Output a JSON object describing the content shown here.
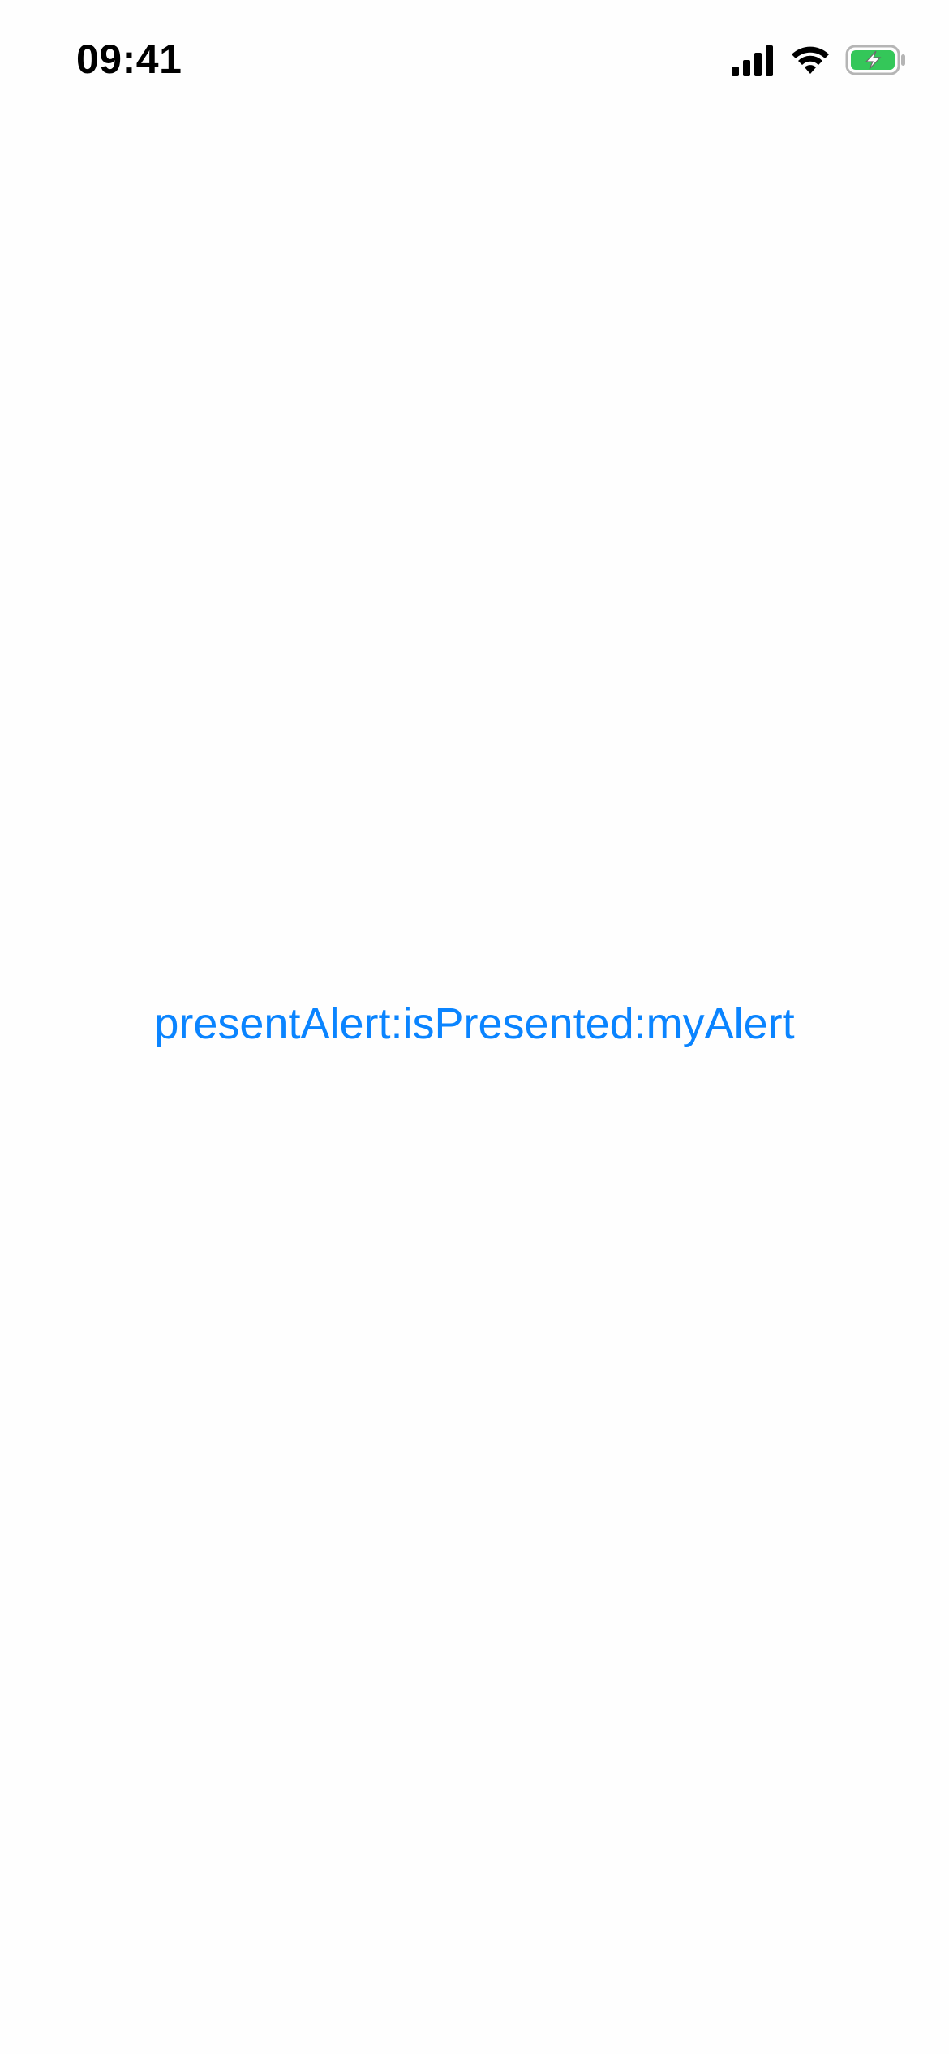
{
  "status_bar": {
    "time": "09:41",
    "icons": [
      "cellular-signal-icon",
      "wifi-icon",
      "battery-charging-icon"
    ],
    "battery_color": "#34c759"
  },
  "main": {
    "button_label": "presentAlert:isPresented:myAlert",
    "accent_color": "#0a84ff"
  }
}
